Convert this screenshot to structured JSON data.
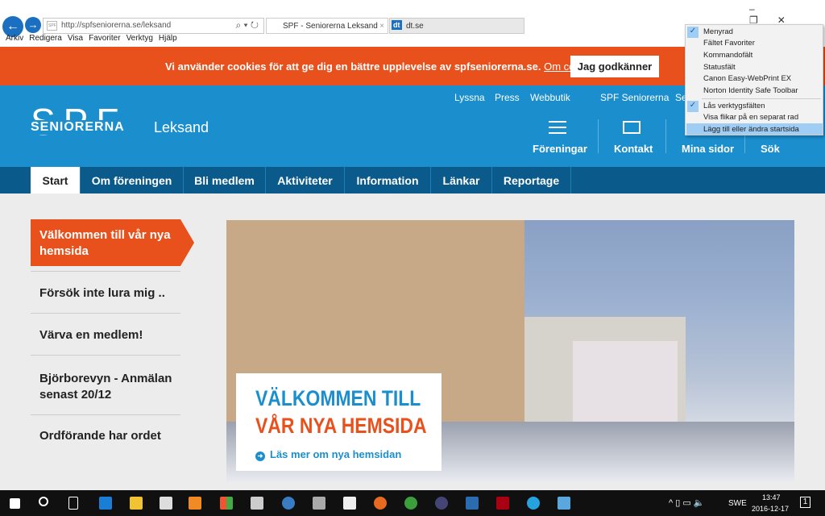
{
  "browser": {
    "url": "http://spfseniorerna.se/leksand",
    "tabs": [
      {
        "label": "SPF - Seniorerna Leksand",
        "active": true
      },
      {
        "label": "dt.se",
        "active": false
      }
    ],
    "menu": [
      "Arkiv",
      "Redigera",
      "Visa",
      "Favoriter",
      "Verktyg",
      "Hjälp"
    ],
    "context_menu": [
      {
        "label": "Menyrad",
        "checked": true
      },
      {
        "label": "Fältet Favoriter"
      },
      {
        "label": "Kommandofält"
      },
      {
        "label": "Statusfält"
      },
      {
        "label": "Canon Easy-WebPrint EX"
      },
      {
        "label": "Norton Identity Safe Toolbar"
      },
      {
        "label": "Lås verktygsfälten",
        "checked": true
      },
      {
        "label": "Visa flikar på en separat rad"
      },
      {
        "label": "Lägg till eller ändra startsida",
        "highlighted": true
      }
    ]
  },
  "cookie": {
    "text": "Vi använder cookies för att ge dig en bättre upplevelse av spfseniorerna.se.",
    "link": "Om cookies",
    "accept": "Jag godkänner"
  },
  "header": {
    "logo_top": "SPF",
    "logo_text": "SENIORERNA",
    "site": "Leksand",
    "top_links": [
      "Lyssna",
      "Press",
      "Webbutik",
      "SPF Seniorerna",
      "Se"
    ],
    "icons": [
      {
        "label": "Föreningar",
        "icon": "list-icon"
      },
      {
        "label": "Kontakt",
        "icon": "mail-icon"
      },
      {
        "label": "Mina sidor"
      },
      {
        "label": "Sök"
      }
    ]
  },
  "nav": [
    "Start",
    "Om föreningen",
    "Bli medlem",
    "Aktiviteter",
    "Information",
    "Länkar",
    "Reportage"
  ],
  "sidebar": [
    "Välkommen till vår nya hemsida",
    "Försök inte lura mig ..",
    "Värva en medlem!",
    "Björborevyn - Anmälan senast 20/12",
    "Ordförande har ordet"
  ],
  "hero": {
    "line1": "VÄLKOMMEN TILL",
    "line2": "VÅR NYA HEMSIDA",
    "link": "Läs mer om nya hemsidan"
  },
  "taskbar": {
    "lang": "SWE",
    "time": "13:47",
    "date": "2016-12-17",
    "notifications": "1"
  },
  "colors": {
    "orange": "#e8501c",
    "blue": "#1b8fce",
    "nav": "#0a5a8c"
  }
}
